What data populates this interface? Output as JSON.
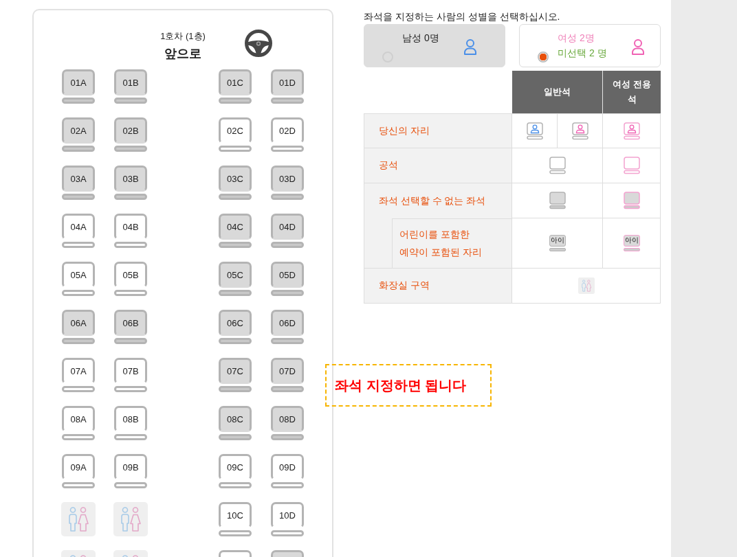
{
  "car": {
    "title": "1호차 (1층)",
    "direction": "앞으로",
    "rows": [
      {
        "seats": [
          {
            "kind": "seat",
            "label": "01A",
            "available": false
          },
          {
            "kind": "seat",
            "label": "01B",
            "available": false
          },
          {
            "kind": "seat",
            "label": "01C",
            "available": false
          },
          {
            "kind": "seat",
            "label": "01D",
            "available": false
          }
        ]
      },
      {
        "seats": [
          {
            "kind": "seat",
            "label": "02A",
            "available": false
          },
          {
            "kind": "seat",
            "label": "02B",
            "available": false
          },
          {
            "kind": "seat",
            "label": "02C",
            "available": true
          },
          {
            "kind": "seat",
            "label": "02D",
            "available": true
          }
        ]
      },
      {
        "seats": [
          {
            "kind": "seat",
            "label": "03A",
            "available": false
          },
          {
            "kind": "seat",
            "label": "03B",
            "available": false
          },
          {
            "kind": "seat",
            "label": "03C",
            "available": false
          },
          {
            "kind": "seat",
            "label": "03D",
            "available": false
          }
        ]
      },
      {
        "seats": [
          {
            "kind": "seat",
            "label": "04A",
            "available": true
          },
          {
            "kind": "seat",
            "label": "04B",
            "available": true
          },
          {
            "kind": "seat",
            "label": "04C",
            "available": false
          },
          {
            "kind": "seat",
            "label": "04D",
            "available": false
          }
        ]
      },
      {
        "seats": [
          {
            "kind": "seat",
            "label": "05A",
            "available": true
          },
          {
            "kind": "seat",
            "label": "05B",
            "available": true
          },
          {
            "kind": "seat",
            "label": "05C",
            "available": false
          },
          {
            "kind": "seat",
            "label": "05D",
            "available": false
          }
        ]
      },
      {
        "seats": [
          {
            "kind": "seat",
            "label": "06A",
            "available": false
          },
          {
            "kind": "seat",
            "label": "06B",
            "available": false
          },
          {
            "kind": "seat",
            "label": "06C",
            "available": false
          },
          {
            "kind": "seat",
            "label": "06D",
            "available": false
          }
        ]
      },
      {
        "seats": [
          {
            "kind": "seat",
            "label": "07A",
            "available": true
          },
          {
            "kind": "seat",
            "label": "07B",
            "available": true
          },
          {
            "kind": "seat",
            "label": "07C",
            "available": false
          },
          {
            "kind": "seat",
            "label": "07D",
            "available": false
          }
        ]
      },
      {
        "seats": [
          {
            "kind": "seat",
            "label": "08A",
            "available": true
          },
          {
            "kind": "seat",
            "label": "08B",
            "available": true
          },
          {
            "kind": "seat",
            "label": "08C",
            "available": false
          },
          {
            "kind": "seat",
            "label": "08D",
            "available": false
          }
        ]
      },
      {
        "seats": [
          {
            "kind": "seat",
            "label": "09A",
            "available": true
          },
          {
            "kind": "seat",
            "label": "09B",
            "available": true
          },
          {
            "kind": "seat",
            "label": "09C",
            "available": true
          },
          {
            "kind": "seat",
            "label": "09D",
            "available": true
          }
        ]
      },
      {
        "seats": [
          {
            "kind": "restroom"
          },
          {
            "kind": "restroom"
          },
          {
            "kind": "seat",
            "label": "10C",
            "available": true
          },
          {
            "kind": "seat",
            "label": "10D",
            "available": true
          }
        ]
      },
      {
        "seats": [
          {
            "kind": "restroom"
          },
          {
            "kind": "restroom"
          },
          {
            "kind": "seat",
            "available": true
          },
          {
            "kind": "seat",
            "available": false
          }
        ]
      }
    ]
  },
  "gender": {
    "prompt": "좌석을 지정하는 사람의 성별을 선택하십시오.",
    "options": [
      {
        "kind": "male",
        "label": "남성 0명",
        "selected": false
      },
      {
        "kind": "female",
        "label": "여성 2명",
        "note": "미선택 2 명",
        "selected": true
      }
    ]
  },
  "legend": {
    "columns": [
      "일반석",
      "여성 전용 석"
    ],
    "rows": [
      {
        "kind": "yours",
        "label": "당신의 자리"
      },
      {
        "kind": "empty",
        "label": "공석"
      },
      {
        "kind": "unavailable",
        "label": "좌석 선택할 수 없는 좌석",
        "children": [
          {
            "kind": "child",
            "label_lines": [
              "어린이를 포함한",
              "예약이 포함된 자리"
            ],
            "cells": [
              {
                "text": "아이"
              },
              {
                "text": "아이"
              }
            ]
          }
        ]
      },
      {
        "kind": "restroom",
        "label": "화장실 구역"
      }
    ]
  },
  "annotation": {
    "text": "좌석 지정하면 됩니다"
  }
}
